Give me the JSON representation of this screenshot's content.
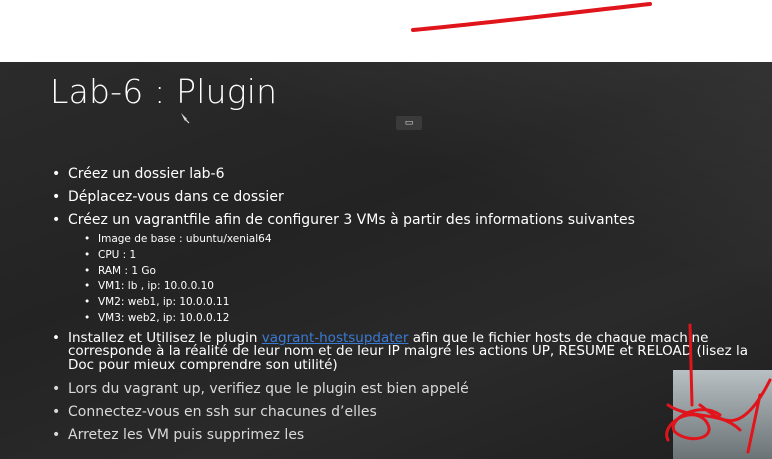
{
  "slide": {
    "title": "Lab-6 : Plugin",
    "toolbar_glyph": "▭",
    "bullets": [
      "Créez un dossier lab-6",
      "Déplacez-vous dans ce dossier",
      "Créez un vagrantfile afin de configurer 3 VMs à partir des informations suivantes"
    ],
    "sub_bullets": [
      "Image de base : ubuntu/xenial64",
      "CPU : 1",
      "RAM : 1 Go",
      "VM1: lb , ip: 10.0.0.10",
      "VM2: web1, ip: 10.0.0.11",
      "VM3: web2, ip: 10.0.0.12"
    ],
    "plugin_bullet": {
      "prefix": "Installez et Utilisez le plugin ",
      "link_text": "vagrant-hostsupdater",
      "suffix": " afin que le fichier hosts de chaque machine",
      "line2": "corresponde à la réalité de leur nom et de leur IP malgré les actions UP, RESUME et RELOAD (lisez la",
      "line3": "Doc pour mieux comprendre son utilité)"
    },
    "final_bullets": [
      "Lors du vagrant up, verifiez que le plugin est bien appelé",
      "Connectez-vous en ssh sur chacunes d’elles",
      "Arretez les VM puis supprimez les"
    ]
  },
  "colors": {
    "slide_background": "#262626",
    "text": "#ffffff",
    "link": "#3a7bd5",
    "annotation_ink": "#e0141b"
  }
}
